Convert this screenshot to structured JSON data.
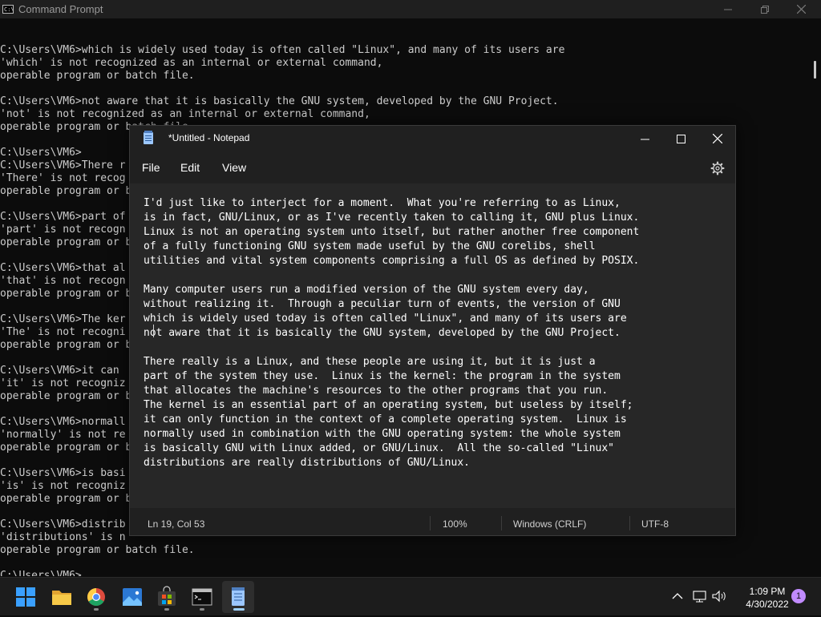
{
  "cmd": {
    "title": "Command Prompt",
    "icon_text": "C:\\",
    "output": [
      "",
      "C:\\Users\\VM6>which is widely used today is often called \"Linux\", and many of its users are",
      "'which' is not recognized as an internal or external command,",
      "operable program or batch file.",
      "",
      "C:\\Users\\VM6>not aware that it is basically the GNU system, developed by the GNU Project.",
      "'not' is not recognized as an internal or external command,",
      "operable program or batch file.",
      "",
      "C:\\Users\\VM6>",
      "C:\\Users\\VM6>There r",
      "'There' is not recog",
      "operable program or b",
      "",
      "C:\\Users\\VM6>part of",
      "'part' is not recogn",
      "operable program or b",
      "",
      "C:\\Users\\VM6>that al",
      "'that' is not recogn",
      "operable program or b",
      "",
      "C:\\Users\\VM6>The ker",
      "'The' is not recogni",
      "operable program or b",
      "",
      "C:\\Users\\VM6>it can",
      "'it' is not recogniz",
      "operable program or b",
      "",
      "C:\\Users\\VM6>normall",
      "'normally' is not re",
      "operable program or b",
      "",
      "C:\\Users\\VM6>is basi",
      "'is' is not recogniz",
      "operable program or b",
      "",
      "C:\\Users\\VM6>distrib",
      "'distributions' is n",
      "operable program or batch file.",
      "",
      "C:\\Users\\VM6>"
    ]
  },
  "notepad": {
    "title": "*Untitled - Notepad",
    "menu": [
      "File",
      "Edit",
      "View"
    ],
    "text_lines": [
      "I'd just like to interject for a moment.  What you're referring to as Linux,",
      "is in fact, GNU/Linux, or as I've recently taken to calling it, GNU plus Linux.",
      "Linux is not an operating system unto itself, but rather another free component",
      "of a fully functioning GNU system made useful by the GNU corelibs, shell",
      "utilities and vital system components comprising a full OS as defined by POSIX.",
      "",
      "Many computer users run a modified version of the GNU system every day,",
      "without realizing it.  Through a peculiar turn of events, the version of GNU",
      "which is widely used today is often called \"Linux\", and many of its users are",
      "not aware that it is basically the GNU system, developed by the GNU Project.",
      "",
      "There really is a Linux, and these people are using it, but it is just a",
      "part of the system they use.  Linux is the kernel: the program in the system",
      "that allocates the machine's resources to the other programs that you run.",
      "The kernel is an essential part of an operating system, but useless by itself;",
      "it can only function in the context of a complete operating system.  Linux is",
      "normally used in combination with the GNU operating system: the whole system",
      "is basically GNU with Linux added, or GNU/Linux.  All the so-called \"Linux\"",
      "distributions are really distributions of GNU/Linux."
    ],
    "status": {
      "position": "Ln 19, Col 53",
      "zoom": "100%",
      "line_ending": "Windows (CRLF)",
      "encoding": "UTF-8"
    }
  },
  "taskbar": {
    "apps": [
      {
        "name": "start",
        "icon": "windows-logo-icon",
        "active": false
      },
      {
        "name": "file-explorer",
        "icon": "folder-icon",
        "active": false
      },
      {
        "name": "chrome",
        "icon": "chrome-icon",
        "active": false,
        "running": true
      },
      {
        "name": "photos",
        "icon": "photos-icon",
        "active": false
      },
      {
        "name": "store",
        "icon": "store-icon",
        "active": false,
        "running": true
      },
      {
        "name": "terminal",
        "icon": "terminal-icon",
        "active": false,
        "running": true
      },
      {
        "name": "notepad",
        "icon": "notepad-icon",
        "active": true,
        "running": true
      }
    ],
    "time": "1:09 PM",
    "date": "4/30/2022",
    "notification_count": "1"
  },
  "colors": {
    "cmd_bg": "#0c0c0c",
    "cmd_text": "#cccccc",
    "notepad_bg": "#272727",
    "accent": "#9fd2ff",
    "badge": "#c18bff"
  }
}
